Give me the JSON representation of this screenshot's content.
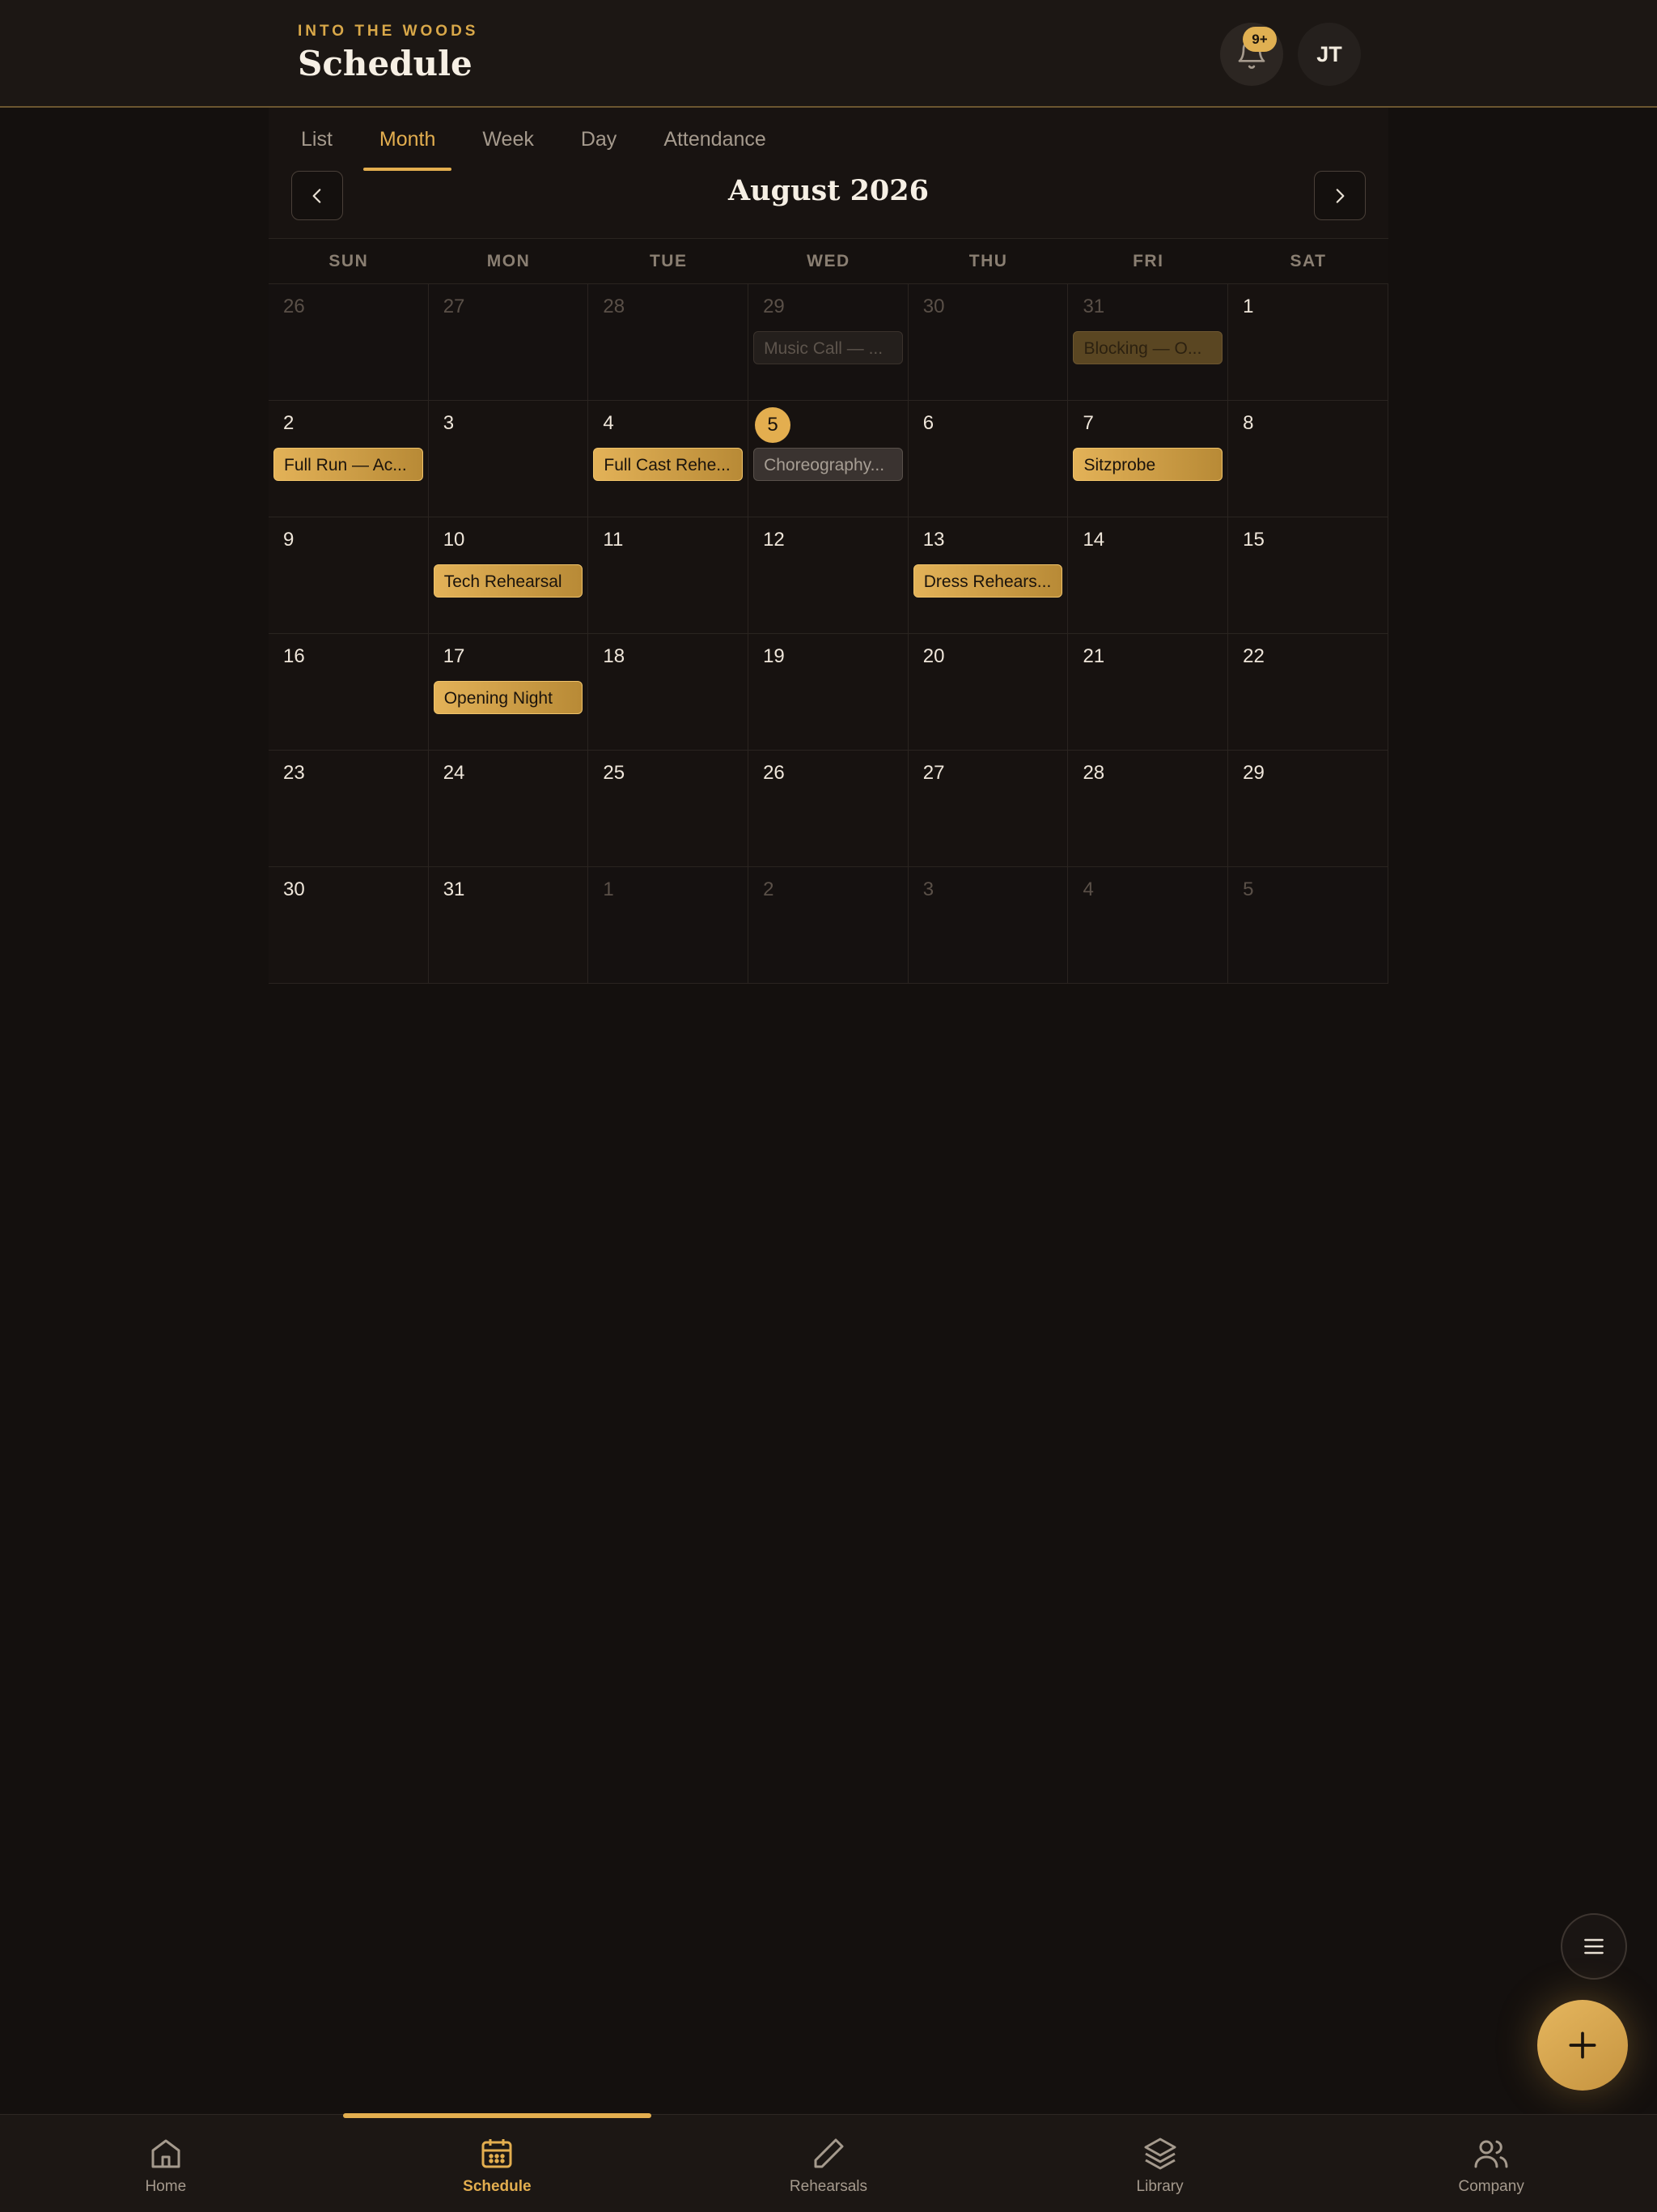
{
  "header": {
    "kicker": "INTO THE WOODS",
    "title": "Schedule",
    "notification_badge": "9+",
    "avatar_initials": "JT"
  },
  "tabs": [
    {
      "label": "List",
      "active": false
    },
    {
      "label": "Month",
      "active": true
    },
    {
      "label": "Week",
      "active": false
    },
    {
      "label": "Day",
      "active": false
    },
    {
      "label": "Attendance",
      "active": false
    }
  ],
  "calendar": {
    "month_title": "August 2026",
    "weekdays": [
      "SUN",
      "MON",
      "TUE",
      "WED",
      "THU",
      "FRI",
      "SAT"
    ],
    "weeks": [
      [
        {
          "day": "26",
          "outside": true
        },
        {
          "day": "27",
          "outside": true
        },
        {
          "day": "28",
          "outside": true
        },
        {
          "day": "29",
          "outside": true,
          "event": "Music Call — ...",
          "event_style": "muted"
        },
        {
          "day": "30",
          "outside": true
        },
        {
          "day": "31",
          "outside": true,
          "event": "Blocking — O...",
          "event_style": "dim"
        },
        {
          "day": "1"
        }
      ],
      [
        {
          "day": "2",
          "event": "Full Run — Ac...",
          "event_style": "gold"
        },
        {
          "day": "3"
        },
        {
          "day": "4",
          "event": "Full Cast Rehe...",
          "event_style": "gold"
        },
        {
          "day": "5",
          "today": true,
          "event": "Choreography...",
          "event_style": "grey"
        },
        {
          "day": "6"
        },
        {
          "day": "7",
          "event": "Sitzprobe",
          "event_style": "gold"
        },
        {
          "day": "8"
        }
      ],
      [
        {
          "day": "9"
        },
        {
          "day": "10",
          "event": "Tech Rehearsal",
          "event_style": "gold"
        },
        {
          "day": "11"
        },
        {
          "day": "12"
        },
        {
          "day": "13",
          "event": "Dress Rehears...",
          "event_style": "gold"
        },
        {
          "day": "14"
        },
        {
          "day": "15"
        }
      ],
      [
        {
          "day": "16"
        },
        {
          "day": "17",
          "event": "Opening Night",
          "event_style": "gold"
        },
        {
          "day": "18"
        },
        {
          "day": "19"
        },
        {
          "day": "20"
        },
        {
          "day": "21"
        },
        {
          "day": "22"
        }
      ],
      [
        {
          "day": "23"
        },
        {
          "day": "24"
        },
        {
          "day": "25"
        },
        {
          "day": "26"
        },
        {
          "day": "27"
        },
        {
          "day": "28"
        },
        {
          "day": "29"
        }
      ],
      [
        {
          "day": "30"
        },
        {
          "day": "31"
        },
        {
          "day": "1",
          "outside": true
        },
        {
          "day": "2",
          "outside": true
        },
        {
          "day": "3",
          "outside": true
        },
        {
          "day": "4",
          "outside": true
        },
        {
          "day": "5",
          "outside": true
        }
      ]
    ]
  },
  "bottom_nav": [
    {
      "label": "Home",
      "icon": "home-icon",
      "active": false
    },
    {
      "label": "Schedule",
      "icon": "calendar-icon",
      "active": true
    },
    {
      "label": "Rehearsals",
      "icon": "pen-icon",
      "active": false
    },
    {
      "label": "Library",
      "icon": "layers-icon",
      "active": false
    },
    {
      "label": "Company",
      "icon": "users-icon",
      "active": false
    }
  ],
  "colors": {
    "accent": "#e3ae4f",
    "background": "#14100e",
    "surface": "#1c1714"
  }
}
